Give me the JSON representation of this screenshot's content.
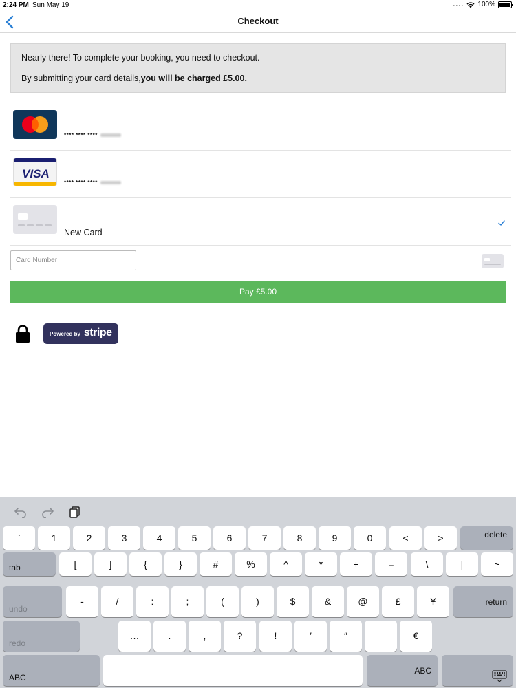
{
  "status_bar": {
    "time": "2:24 PM",
    "date": "Sun May 19",
    "battery": "100%"
  },
  "nav": {
    "title": "Checkout",
    "back_icon": "chevron-left-icon"
  },
  "info": {
    "line1": "Nearly there! To complete your booking, you need to checkout.",
    "line2_prefix": "By submitting your card details,",
    "line2_bold": "you will be charged £5.00."
  },
  "saved_cards": [
    {
      "brand": "mastercard",
      "masked": "**** **** ****"
    },
    {
      "brand": "visa",
      "brand_text": "VISA",
      "masked": "**** **** ****"
    }
  ],
  "new_card": {
    "label": "New Card",
    "selected": true
  },
  "card_input": {
    "placeholder": "Card Number",
    "value": ""
  },
  "pay_button": {
    "label": "Pay £5.00"
  },
  "stripe_badge": {
    "powered": "Powered by",
    "brand": "stripe"
  },
  "colors": {
    "accent": "#2a7fd4",
    "pay_green": "#5cb85c",
    "stripe_navy": "#32325d",
    "info_bg": "#e5e5e5"
  },
  "keyboard": {
    "row1": [
      "`",
      "1",
      "2",
      "3",
      "4",
      "5",
      "6",
      "7",
      "8",
      "9",
      "0",
      "<",
      ">",
      "delete"
    ],
    "row2": [
      "tab",
      "[",
      "]",
      "{",
      "}",
      "#",
      "%",
      "^",
      "*",
      "+",
      "=",
      "\\",
      "|",
      "~"
    ],
    "row3": [
      "undo",
      "-",
      "/",
      ":",
      ";",
      "(",
      ")",
      "$",
      "&",
      "@",
      "£",
      "¥",
      "return"
    ],
    "row4": [
      "redo",
      "…",
      ".",
      ",",
      "?",
      "!",
      "′",
      "″",
      "_",
      "€"
    ],
    "row5": [
      "ABC",
      "",
      "ABC"
    ]
  }
}
